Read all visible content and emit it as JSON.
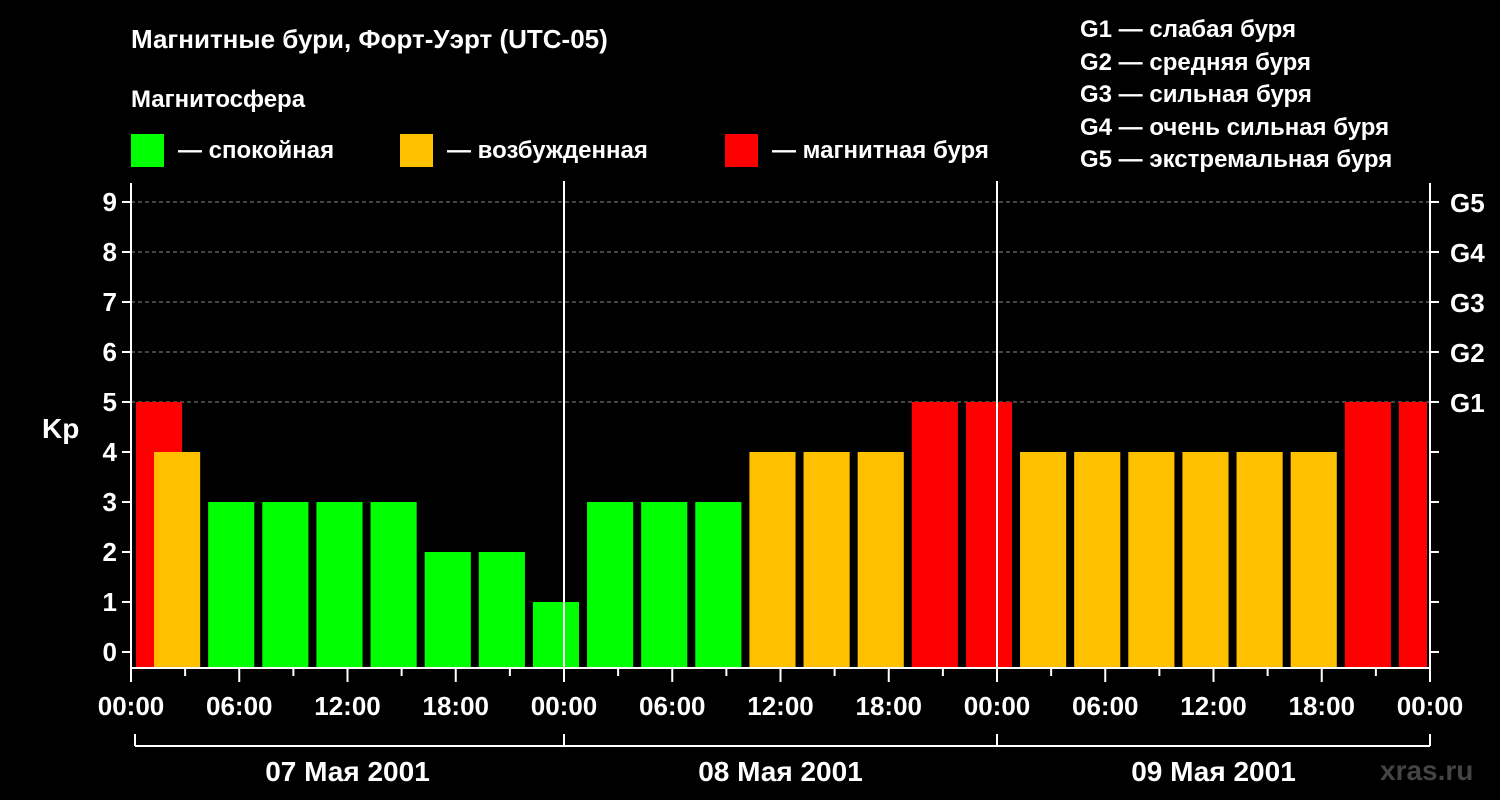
{
  "title": "Магнитные бури, Форт-Уэрт (UTC-05)",
  "magnetosphere_label": "Магнитосфера",
  "legend": [
    {
      "label": "— спокойная",
      "color": "#00ff00"
    },
    {
      "label": "— возбужденная",
      "color": "#ffc000"
    },
    {
      "label": "— магнитная буря",
      "color": "#ff0000"
    }
  ],
  "g_scale": [
    "G1 — слабая буря",
    "G2 — средняя буря",
    "G3 — сильная буря",
    "G4 — очень сильная буря",
    "G5 — экстремальная буря"
  ],
  "watermark": "xras.ru",
  "chart_data": {
    "type": "bar",
    "ylabel": "Kp",
    "ylim": [
      0,
      9
    ],
    "y_ticks": [
      "0",
      "1",
      "2",
      "3",
      "4",
      "5",
      "6",
      "7",
      "8",
      "9"
    ],
    "g_ticks": [
      {
        "label": "G1",
        "kp": 5
      },
      {
        "label": "G2",
        "kp": 6
      },
      {
        "label": "G3",
        "kp": 7
      },
      {
        "label": "G4",
        "kp": 8
      },
      {
        "label": "G5",
        "kp": 9
      }
    ],
    "x_tick_labels": [
      "00:00",
      "06:00",
      "12:00",
      "18:00",
      "00:00",
      "06:00",
      "12:00",
      "18:00",
      "00:00",
      "06:00",
      "12:00",
      "18:00",
      "00:00",
      "06:00",
      "12:00",
      "18:00",
      "00:00"
    ],
    "dates": [
      "07 Мая 2001",
      "08 Мая 2001",
      "09 Мая 2001"
    ],
    "grid": "horizontal dashed at Kp 5–9",
    "color_scale": {
      "quiet": "#00ff00",
      "active": "#ffc000",
      "storm": "#ff0000"
    },
    "bars": [
      {
        "start_hour": 0,
        "kp": 5
      },
      {
        "start_hour": 1,
        "kp": 4
      },
      {
        "start_hour": 4,
        "kp": 3
      },
      {
        "start_hour": 7,
        "kp": 3
      },
      {
        "start_hour": 10,
        "kp": 3
      },
      {
        "start_hour": 13,
        "kp": 3
      },
      {
        "start_hour": 16,
        "kp": 2
      },
      {
        "start_hour": 19,
        "kp": 2
      },
      {
        "start_hour": 22,
        "kp": 1
      },
      {
        "start_hour": 25,
        "kp": 3
      },
      {
        "start_hour": 28,
        "kp": 3
      },
      {
        "start_hour": 31,
        "kp": 3
      },
      {
        "start_hour": 34,
        "kp": 4
      },
      {
        "start_hour": 37,
        "kp": 4
      },
      {
        "start_hour": 40,
        "kp": 4
      },
      {
        "start_hour": 43,
        "kp": 5
      },
      {
        "start_hour": 46,
        "kp": 5
      },
      {
        "start_hour": 49,
        "kp": 4
      },
      {
        "start_hour": 52,
        "kp": 4
      },
      {
        "start_hour": 55,
        "kp": 4
      },
      {
        "start_hour": 58,
        "kp": 4
      },
      {
        "start_hour": 61,
        "kp": 4
      },
      {
        "start_hour": 64,
        "kp": 4
      },
      {
        "start_hour": 67,
        "kp": 5
      },
      {
        "start_hour": 70,
        "kp": 5
      }
    ]
  }
}
